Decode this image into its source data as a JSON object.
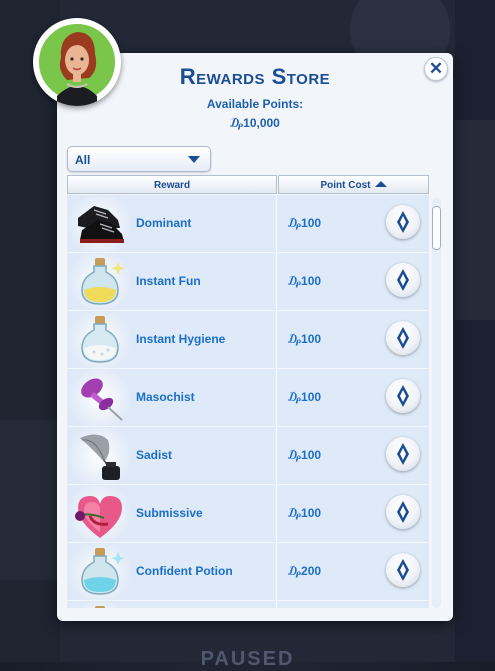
{
  "dialog": {
    "title": "Rewards Store",
    "available_label": "Available Points:",
    "available_value": "₯10,000"
  },
  "filter": {
    "selected": "All"
  },
  "columns": {
    "reward": "Reward",
    "cost": "Point Cost",
    "sort": "ascending"
  },
  "rewards": [
    {
      "name": "Dominant",
      "cost": "₯100",
      "icon": "black-boots-icon"
    },
    {
      "name": "Instant Fun",
      "cost": "₯100",
      "icon": "yellow-potion-icon"
    },
    {
      "name": "Instant Hygiene",
      "cost": "₯100",
      "icon": "white-potion-icon"
    },
    {
      "name": "Masochist",
      "cost": "₯100",
      "icon": "purple-pushpin-icon"
    },
    {
      "name": "Sadist",
      "cost": "₯100",
      "icon": "quill-inkwell-icon"
    },
    {
      "name": "Submissive",
      "cost": "₯100",
      "icon": "heart-rose-icon"
    },
    {
      "name": "Confident Potion",
      "cost": "₯200",
      "icon": "blue-potion-icon"
    },
    {
      "name": "",
      "cost": "",
      "icon": "potion-icon"
    }
  ],
  "background": {
    "label": "PAUSED"
  },
  "colors": {
    "accent": "#1a4d94",
    "link": "#1b6fc9",
    "row": "#dfeaf9",
    "panel": "#f2f5fa"
  }
}
